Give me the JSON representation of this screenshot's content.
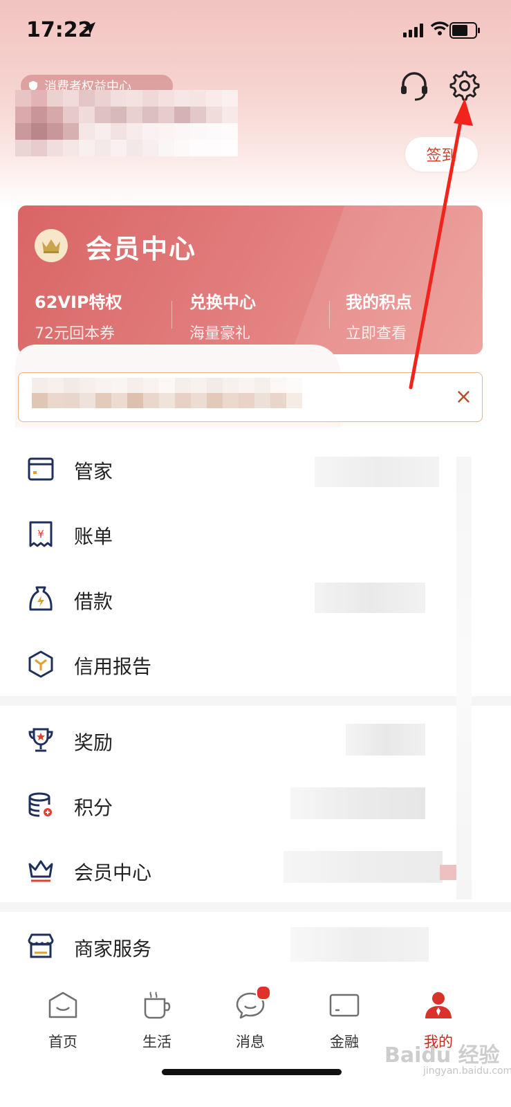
{
  "status_bar": {
    "time": "17:22"
  },
  "header": {
    "badge_text": "消费者权益中心",
    "sign_in_label": "签到"
  },
  "vip_card": {
    "title": "会员中心",
    "columns": [
      {
        "title": "62VIP特权",
        "subtitle": "72元回本券"
      },
      {
        "title": "兑换中心",
        "subtitle": "海量豪礼"
      },
      {
        "title": "我的积点",
        "subtitle": "立即查看"
      }
    ]
  },
  "notice": {
    "close_glyph": "×"
  },
  "menu_group1": [
    {
      "label": "管家",
      "icon": "card-icon"
    },
    {
      "label": "账单",
      "icon": "bill-icon"
    },
    {
      "label": "借款",
      "icon": "loan-bag-icon"
    },
    {
      "label": "信用报告",
      "icon": "credit-report-icon"
    }
  ],
  "menu_group2": [
    {
      "label": "奖励",
      "icon": "trophy-icon"
    },
    {
      "label": "积分",
      "icon": "points-coins-icon"
    },
    {
      "label": "会员中心",
      "icon": "crown-icon"
    }
  ],
  "menu_group3": [
    {
      "label": "商家服务",
      "icon": "store-icon"
    }
  ],
  "tabbar": [
    {
      "label": "首页",
      "icon": "home-icon",
      "active": false
    },
    {
      "label": "生活",
      "icon": "cup-icon",
      "active": false
    },
    {
      "label": "消息",
      "icon": "message-icon",
      "active": false,
      "badge": true
    },
    {
      "label": "金融",
      "icon": "finance-icon",
      "active": false
    },
    {
      "label": "我的",
      "icon": "profile-icon",
      "active": true
    }
  ],
  "watermark": {
    "text": "Baidu 经验",
    "sub": "jingyan.baidu.com"
  },
  "colors": {
    "accent": "#c8281e",
    "vip_card": "#d96565",
    "icon_blue": "#1f2f5c",
    "notice_border": "#e8b48c"
  }
}
